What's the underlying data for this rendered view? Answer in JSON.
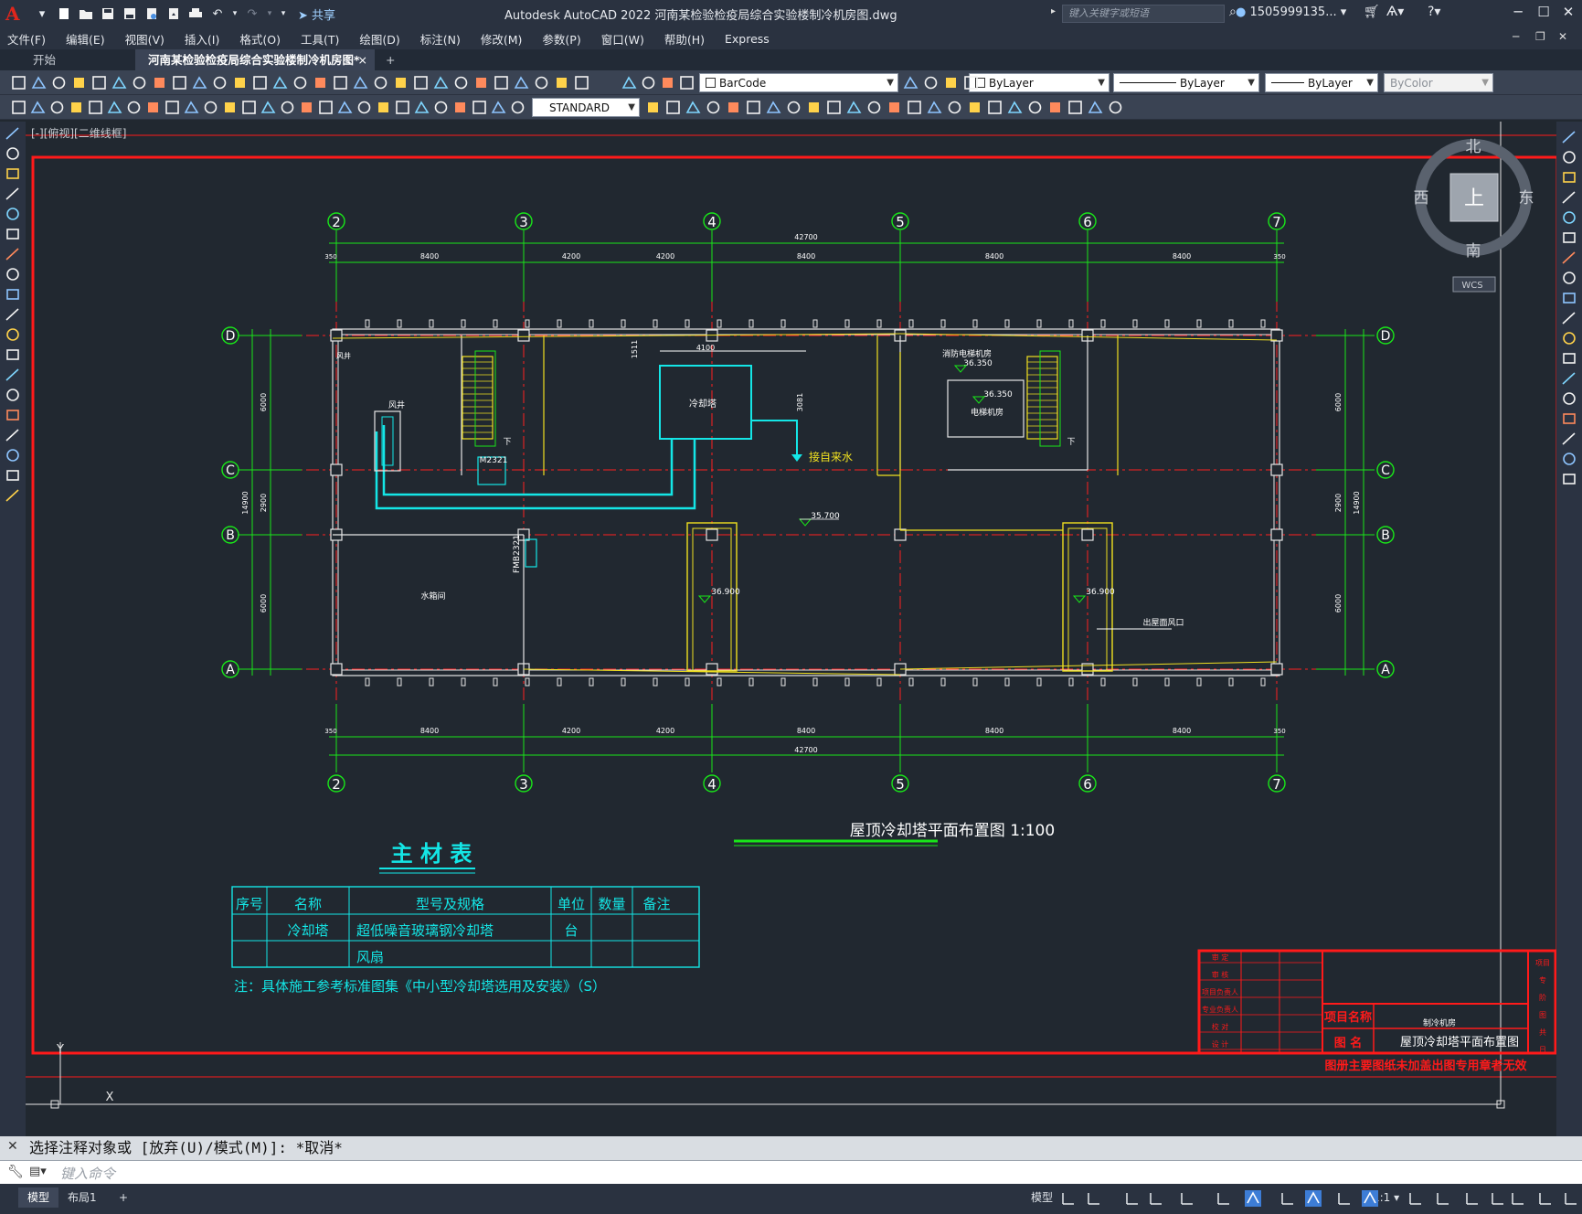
{
  "app": {
    "title": "Autodesk AutoCAD 2022    河南某检验检疫局综合实验楼制冷机房图.dwg",
    "share_label": "共享",
    "search_placeholder": "键入关键字或短语",
    "user_name": "1505999135...",
    "logo_letter": "A"
  },
  "menu": [
    "文件(F)",
    "编辑(E)",
    "视图(V)",
    "插入(I)",
    "格式(O)",
    "工具(T)",
    "绘图(D)",
    "标注(N)",
    "修改(M)",
    "参数(P)",
    "窗口(W)",
    "帮助(H)",
    "Express"
  ],
  "tabs": {
    "start": "开始",
    "drawing": "河南某检验检疫局综合实验楼制冷机房图*",
    "close": "×",
    "add": "+"
  },
  "toolbar": {
    "layer_value": "BarCode",
    "color_value": "ByLayer",
    "linetype_value": "ByLayer",
    "lineweight_value": "ByLayer",
    "plotstyle_value": "ByColor",
    "textstyle_value": "STANDARD"
  },
  "viewport": {
    "label": "[-][俯视][二维线框]",
    "viewcube_top": "上",
    "north": "北",
    "south": "南",
    "east": "东",
    "west": "西",
    "wcs": "WCS"
  },
  "drawing": {
    "grid_cols": [
      "2",
      "3",
      "4",
      "5",
      "6",
      "7"
    ],
    "grid_rows": [
      "D",
      "C",
      "B",
      "A"
    ],
    "dims_top": [
      "8400",
      "4200",
      "4200",
      "8400",
      "8400",
      "8400"
    ],
    "dim_total": "42700",
    "dim_edge": "350",
    "dims_left": [
      "6000",
      "2900",
      "6000"
    ],
    "dim_left_total": "14900",
    "room_labels": {
      "fengjing": "风井",
      "fengjing2": "风井",
      "cooling_tower": "冷却塔",
      "water_supply": "接自来水",
      "fire_elevator": "消防电梯机房",
      "elevator": "电梯机房",
      "water_tank": "水箱间",
      "roof_vent": "出屋面风口",
      "door1": "M2321",
      "door2": "FMB2321",
      "down1": "下",
      "down2": "下"
    },
    "elevations": [
      "36.350",
      "36.350",
      "35.700",
      "36.900",
      "36.900"
    ],
    "cooling_dims": [
      "4100",
      "1511",
      "3081"
    ],
    "plan_title": "屋顶冷却塔平面布置图  1:100"
  },
  "material_table": {
    "title": "主 材 表",
    "headers": [
      "序号",
      "名称",
      "型号及规格",
      "单位",
      "数量",
      "备注"
    ],
    "rows": [
      [
        "",
        "冷却塔",
        "超低噪音玻璃钢冷却塔",
        "台",
        "",
        ""
      ],
      [
        "",
        "",
        "风扇",
        "",
        "",
        ""
      ]
    ],
    "note": "注：具体施工参考标准图集《中小型冷却塔选用及安装》（S）"
  },
  "title_block": {
    "project_name_label": "项目名称",
    "project_name_value": "制冷机房",
    "drawing_name_label": "图    名",
    "drawing_name_value": "屋顶冷却塔平面布置图",
    "warning": "图册主要图纸未加盖出图专用章者无效",
    "roles": [
      "审  定",
      "审  核",
      "项目负责人",
      "专业负责人",
      "校  对",
      "设  计"
    ],
    "right_labels": [
      "项目",
      "专",
      "阶",
      "图",
      "共",
      "日"
    ]
  },
  "command": {
    "history": "选择注释对象或 [放弃(U)/模式(M)]: *取消*",
    "placeholder": "键入命令"
  },
  "status": {
    "model_tab": "模型",
    "layout_tab": "布局1",
    "add_tab": "+",
    "model_space": "模型",
    "scale": "1:1"
  },
  "colors": {
    "grid_red": "#ff2020",
    "grid_green": "#19e619",
    "wall": "#e6e6e6",
    "cyan": "#14e6e6",
    "yellow": "#f0e020",
    "frame_red": "#ff1a1a"
  }
}
